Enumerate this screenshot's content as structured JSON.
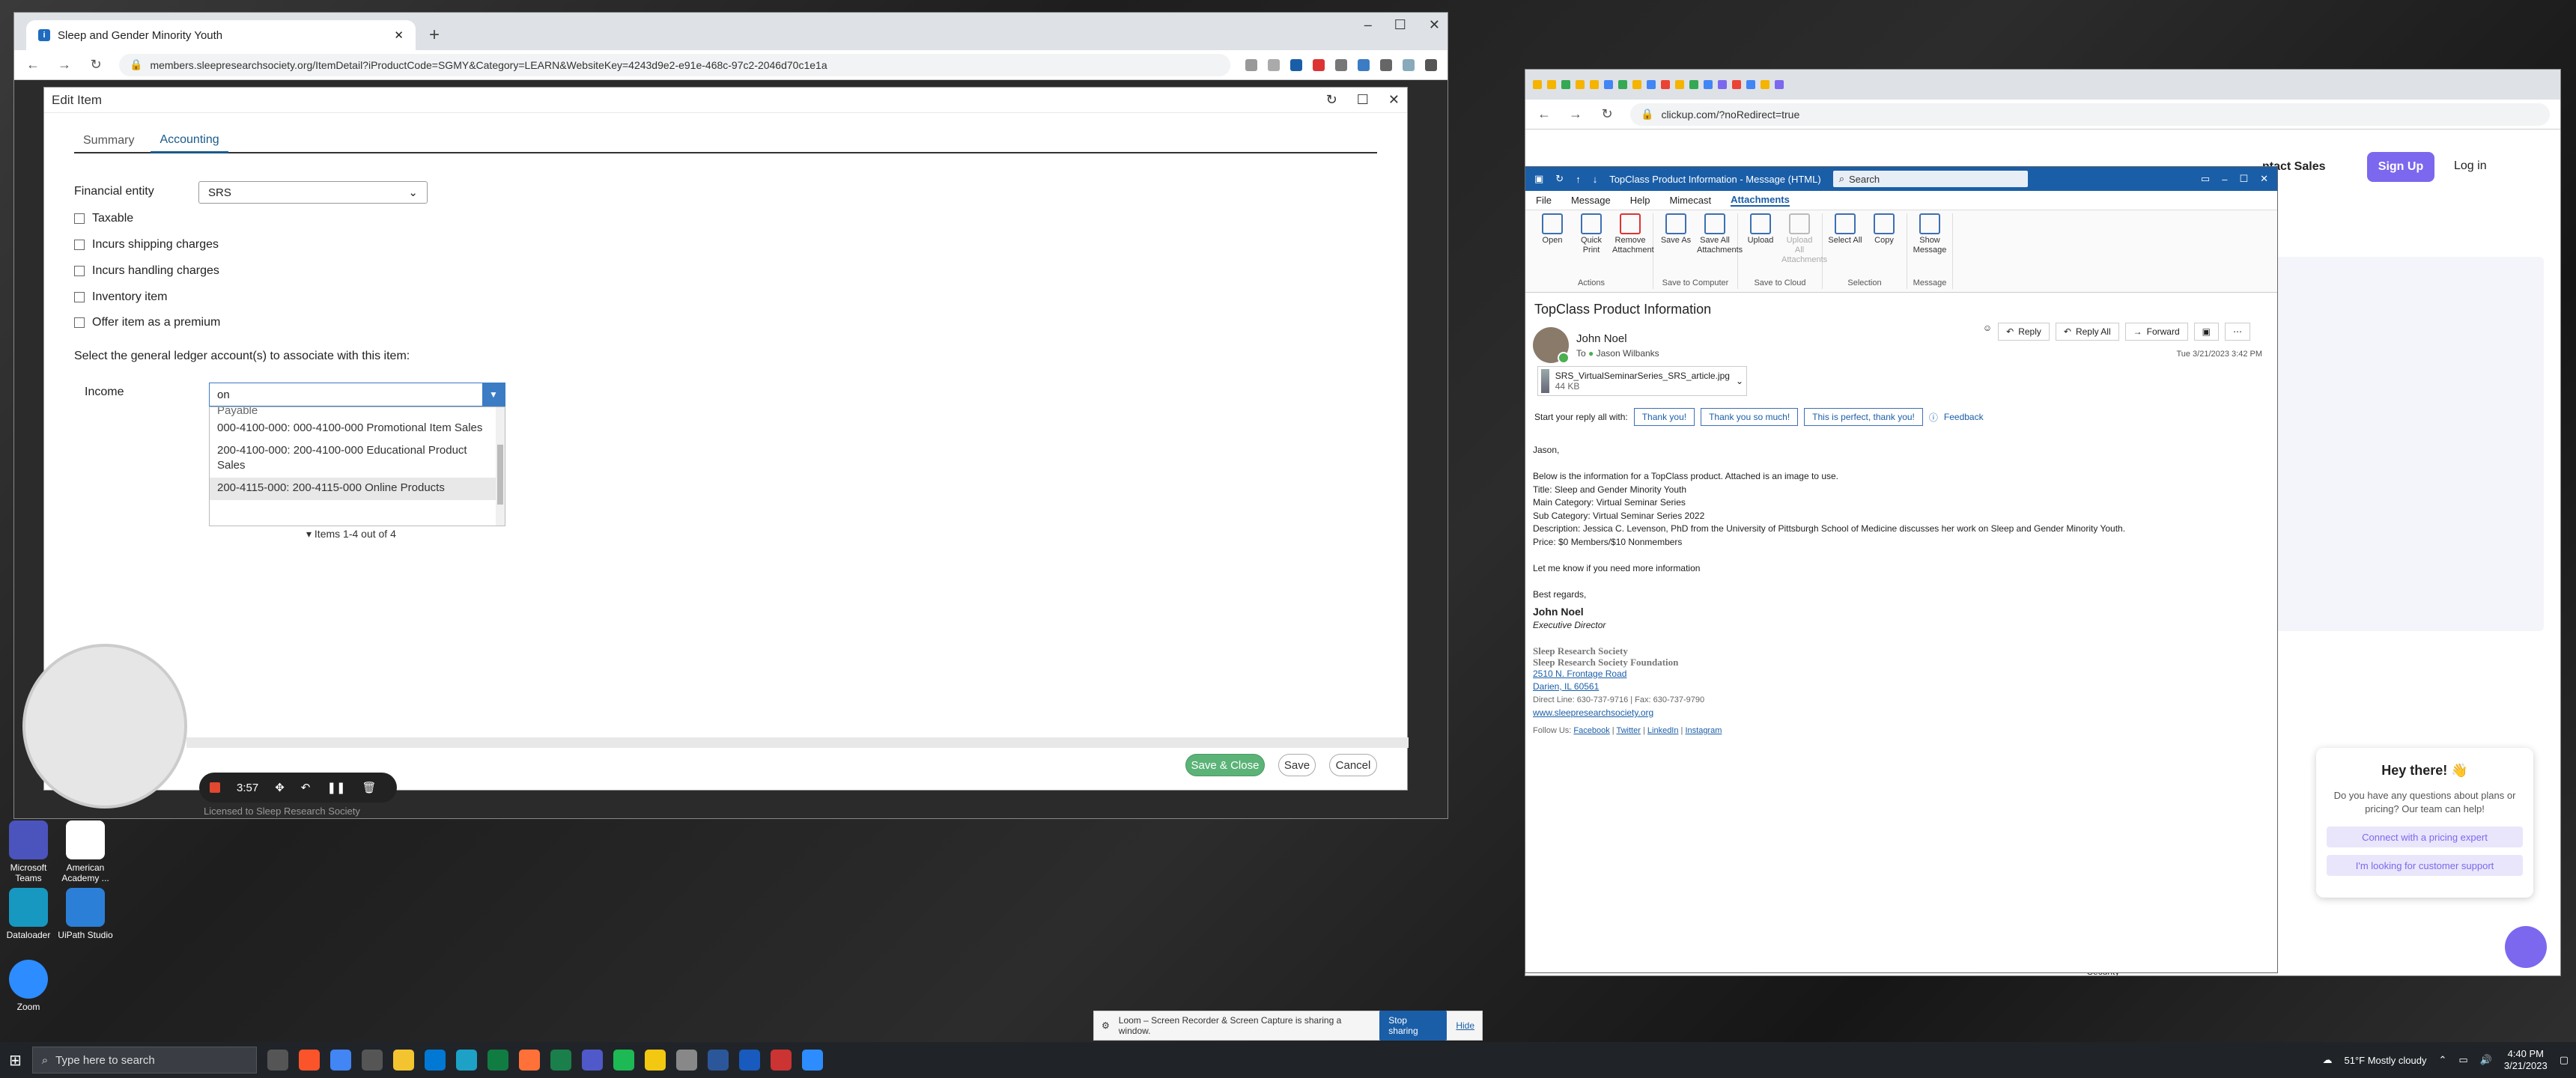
{
  "chrome_left": {
    "tab_title": "Sleep and Gender Minority Youth",
    "url": "members.sleepresearchsociety.org/ItemDetail?iProductCode=SGMY&Category=LEARN&WebsiteKey=4243d9e2-e91e-468c-97c2-2046d70c1e1a",
    "favicon": "i",
    "window_controls": {
      "minimize": "–",
      "maximize": "☐",
      "close": "✕"
    }
  },
  "edit_item": {
    "title": "Edit Item",
    "tabs": [
      {
        "label": "Summary"
      },
      {
        "label": "Accounting"
      }
    ],
    "financial_entity_label": "Financial entity",
    "financial_entity_value": "SRS",
    "checkboxes": [
      {
        "label": "Taxable"
      },
      {
        "label": "Incurs shipping charges"
      },
      {
        "label": "Incurs handling charges"
      },
      {
        "label": "Inventory item"
      },
      {
        "label": "Offer item as a premium"
      }
    ],
    "gl_prompt": "Select the general ledger account(s) to associate with this item:",
    "income_label": "Income",
    "income_input": "on",
    "dropdown_options": [
      {
        "label": "Payable"
      },
      {
        "label": "000-4100-000: 000-4100-000 Promotional Item Sales"
      },
      {
        "label": "200-4100-000: 200-4100-000 Educational Product Sales"
      },
      {
        "label": "200-4115-000: 200-4115-000 Online Products"
      }
    ],
    "pager": "Items 1-4 out of 4",
    "buttons": {
      "save_close": "Save & Close",
      "save": "Save",
      "cancel": "Cancel"
    }
  },
  "loom_controls": {
    "timer": "3:57"
  },
  "licensed_text": "Licensed to Sleep Research Society",
  "desktop_icons": [
    {
      "label": "Microsoft Teams",
      "color": "#4b53bc"
    },
    {
      "label": "American Academy ...",
      "color": "#ffffff"
    },
    {
      "label": "Dataloader",
      "color": "#1798c1"
    },
    {
      "label": "UiPath Studio",
      "color": "#2c7fd6"
    },
    {
      "label": "Zoom",
      "color": "#2d8cff"
    }
  ],
  "chrome_right": {
    "url": "clickup.com/?noRedirect=true",
    "contact_sales": "ntact Sales",
    "sign_up": "Sign Up",
    "log_in": "Log in",
    "chat": {
      "title": "Hey there! 👋",
      "text": "Do you have any questions about plans or pricing? Our team can help!",
      "button1": "Connect with a pricing expert",
      "button2": "I'm looking for customer support"
    },
    "security": "Security"
  },
  "outlook": {
    "window_title": "TopClass Product Information - Message (HTML)",
    "search_placeholder": "Search",
    "menu": [
      {
        "label": "File"
      },
      {
        "label": "Message"
      },
      {
        "label": "Help"
      },
      {
        "label": "Mimecast"
      },
      {
        "label": "Attachments"
      }
    ],
    "ribbon_groups": [
      {
        "label": "Actions",
        "buttons": [
          {
            "label": "Open"
          },
          {
            "label": "Quick Print"
          },
          {
            "label": "Remove Attachment"
          }
        ]
      },
      {
        "label": "Save to Computer",
        "buttons": [
          {
            "label": "Save As"
          },
          {
            "label": "Save All Attachments"
          }
        ]
      },
      {
        "label": "Save to Cloud",
        "buttons": [
          {
            "label": "Upload"
          },
          {
            "label": "Upload All Attachments"
          }
        ]
      },
      {
        "label": "Selection",
        "buttons": [
          {
            "label": "Select All"
          },
          {
            "label": "Copy"
          }
        ]
      },
      {
        "label": "Message",
        "buttons": [
          {
            "label": "Show Message"
          }
        ]
      }
    ],
    "subject": "TopClass Product Information",
    "sender": "John Noel",
    "to_label": "To",
    "to": "Jason Wilbanks",
    "actions": {
      "reply": "Reply",
      "reply_all": "Reply All",
      "forward": "Forward"
    },
    "date": "Tue 3/21/2023 3:42 PM",
    "attachment": {
      "name": "SRS_VirtualSeminarSeries_SRS_article.jpg",
      "size": "44 KB"
    },
    "quick_reply_prompt": "Start your reply all with:",
    "quick_replies": [
      {
        "label": "Thank you!"
      },
      {
        "label": "Thank you so much!"
      },
      {
        "label": "This is perfect, thank you!"
      }
    ],
    "feedback": "Feedback",
    "body": {
      "greeting": "Jason,",
      "intro": "Below is the information for a TopClass product. Attached is an image to use.",
      "title": "Title:  Sleep and Gender Minority Youth",
      "main_category": "Main Category: Virtual Seminar Series",
      "sub_category": "Sub Category:  Virtual Seminar Series 2022",
      "description": "Description: Jessica C. Levenson, PhD from the University of Pittsburgh School of Medicine discusses her work on Sleep and Gender Minority Youth.",
      "price": "Price: $0 Members/$10 Nonmembers",
      "closing": "Let me know if you need more information",
      "regards": "Best regards,"
    },
    "signature": {
      "name": "John Noel",
      "title": "Executive Director",
      "org1": "Sleep Research Society",
      "org2": "Sleep Research Society Foundation",
      "addr1": "2510 N. Frontage Road",
      "addr2": "Darien, IL 60561",
      "phone": "Direct Line: 630-737-9716 | Fax: 630-737-9790",
      "web": "www.sleepresearchsociety.org",
      "follow": "Follow Us:",
      "social": [
        {
          "label": "Facebook"
        },
        {
          "label": "Twitter"
        },
        {
          "label": "LinkedIn"
        },
        {
          "label": "Instagram"
        }
      ]
    }
  },
  "share_bar": {
    "text": "Loom – Screen Recorder & Screen Capture is sharing a window.",
    "stop": "Stop sharing",
    "hide": "Hide"
  },
  "taskbar": {
    "search_placeholder": "Type here to search",
    "weather": "51°F  Mostly cloudy",
    "time": "4:40 PM",
    "date": "3/21/2023"
  }
}
